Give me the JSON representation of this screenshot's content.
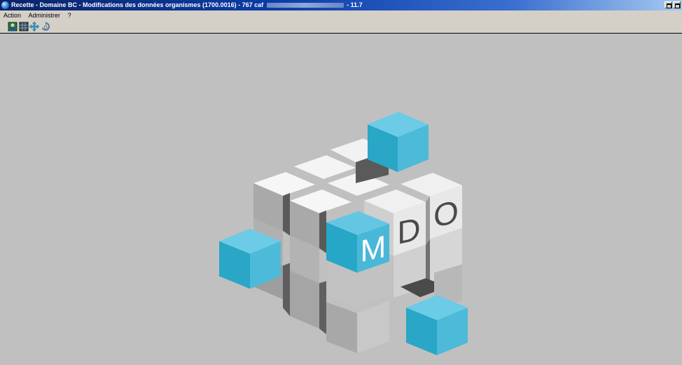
{
  "window": {
    "title_prefix": "Recette - Domaine BC - Modifications des données organismes (1700.0016) - 767 caf",
    "title_suffix": "- 11.7"
  },
  "menu": {
    "items": [
      "Action",
      "Administrer",
      "?"
    ]
  },
  "toolbar": {
    "icons": [
      "user-icon",
      "grid-icon",
      "move-arrows-icon",
      "refresh-icon"
    ]
  },
  "logo": {
    "letters": [
      "M",
      "D",
      "O"
    ],
    "accent_color": "#2fb2d0"
  }
}
